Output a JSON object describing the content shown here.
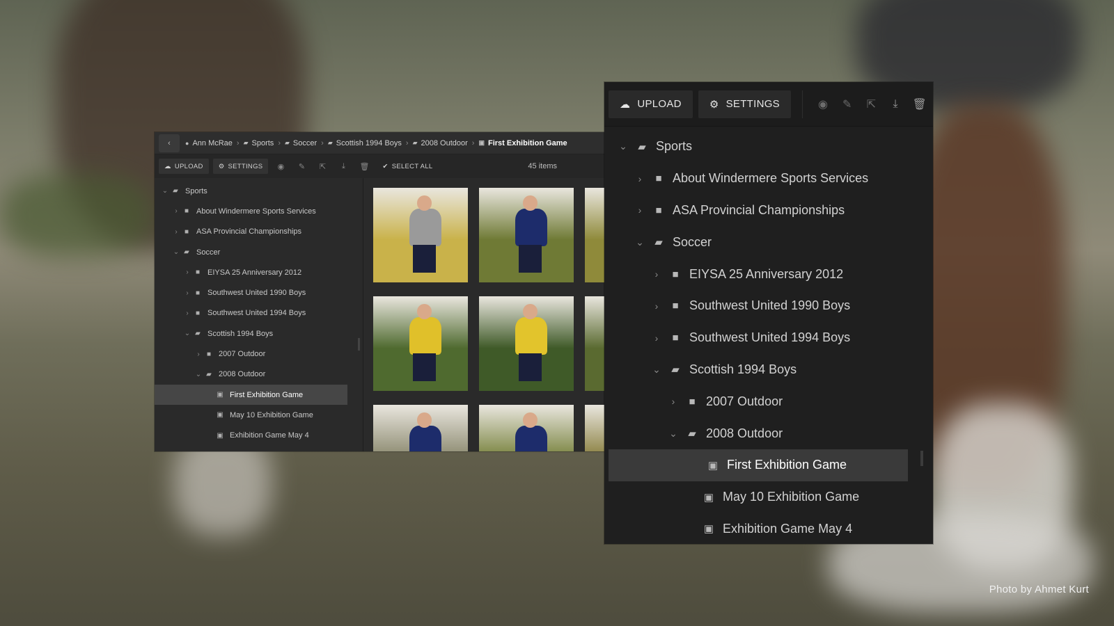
{
  "photo_credit": "Photo by Ahmet Kurt",
  "small_window": {
    "breadcrumbs": [
      {
        "label": "Ann McRae",
        "icon": "user-icon"
      },
      {
        "label": "Sports",
        "icon": "folder-open-icon"
      },
      {
        "label": "Soccer",
        "icon": "folder-open-icon"
      },
      {
        "label": "Scottish 1994 Boys",
        "icon": "folder-open-icon"
      },
      {
        "label": "2008 Outdoor",
        "icon": "folder-open-icon"
      },
      {
        "label": "First Exhibition Game",
        "icon": "gallery-icon"
      }
    ],
    "toolbar": {
      "upload_label": "UPLOAD",
      "settings_label": "SETTINGS",
      "select_all_label": "SELECT ALL",
      "item_count": "45 items"
    },
    "tree": [
      {
        "label": "Sports",
        "depth": 0,
        "chevron": "down",
        "icon": "folder-open-icon"
      },
      {
        "label": "About Windermere Sports Services",
        "depth": 1,
        "chevron": "right",
        "icon": "folder-icon"
      },
      {
        "label": "ASA Provincial Championships",
        "depth": 1,
        "chevron": "right",
        "icon": "folder-icon"
      },
      {
        "label": "Soccer",
        "depth": 1,
        "chevron": "down",
        "icon": "folder-open-icon"
      },
      {
        "label": "EIYSA 25 Anniversary 2012",
        "depth": 2,
        "chevron": "right",
        "icon": "folder-icon"
      },
      {
        "label": "Southwest United 1990 Boys",
        "depth": 2,
        "chevron": "right",
        "icon": "folder-icon"
      },
      {
        "label": "Southwest United 1994 Boys",
        "depth": 2,
        "chevron": "right",
        "icon": "folder-icon"
      },
      {
        "label": "Scottish  1994 Boys",
        "depth": 2,
        "chevron": "down",
        "icon": "folder-open-icon"
      },
      {
        "label": "2007 Outdoor",
        "depth": 3,
        "chevron": "right",
        "icon": "folder-icon"
      },
      {
        "label": "2008 Outdoor",
        "depth": 3,
        "chevron": "down",
        "icon": "folder-open-icon"
      },
      {
        "label": "First Exhibition Game",
        "depth": 4,
        "chevron": "none",
        "icon": "gallery-icon",
        "selected": true
      },
      {
        "label": "May 10 Exhibition Game",
        "depth": 4,
        "chevron": "none",
        "icon": "gallery-icon"
      },
      {
        "label": "Exhibition Game May 4",
        "depth": 4,
        "chevron": "none",
        "icon": "gallery-icon"
      }
    ]
  },
  "large_panel": {
    "toolbar": {
      "upload_label": "UPLOAD",
      "settings_label": "SETTINGS"
    },
    "tree": [
      {
        "label": "Sports",
        "depth": 0,
        "chevron": "down",
        "icon": "folder-open-icon"
      },
      {
        "label": "About Windermere Sports Services",
        "depth": 1,
        "chevron": "right",
        "icon": "folder-icon"
      },
      {
        "label": "ASA Provincial Championships",
        "depth": 1,
        "chevron": "right",
        "icon": "folder-icon"
      },
      {
        "label": "Soccer",
        "depth": 1,
        "chevron": "down",
        "icon": "folder-open-icon"
      },
      {
        "label": "EIYSA 25 Anniversary 2012",
        "depth": 2,
        "chevron": "right",
        "icon": "folder-icon"
      },
      {
        "label": "Southwest United 1990 Boys",
        "depth": 2,
        "chevron": "right",
        "icon": "folder-icon"
      },
      {
        "label": "Southwest United 1994 Boys",
        "depth": 2,
        "chevron": "right",
        "icon": "folder-icon"
      },
      {
        "label": "Scottish  1994 Boys",
        "depth": 2,
        "chevron": "down",
        "icon": "folder-open-icon"
      },
      {
        "label": "2007 Outdoor",
        "depth": 3,
        "chevron": "right",
        "icon": "folder-icon"
      },
      {
        "label": "2008 Outdoor",
        "depth": 3,
        "chevron": "down",
        "icon": "folder-open-icon"
      },
      {
        "label": "First Exhibition Game",
        "depth": 4,
        "chevron": "none",
        "icon": "gallery-icon",
        "selected": true
      },
      {
        "label": "May 10 Exhibition Game",
        "depth": 4,
        "chevron": "none",
        "icon": "gallery-icon"
      },
      {
        "label": "Exhibition Game May 4",
        "depth": 4,
        "chevron": "none",
        "icon": "gallery-icon"
      }
    ]
  },
  "thumbnails": [
    {
      "name": "goalkeeper-photo",
      "bg": "#c9b24a",
      "jersey": "#9a9a9a"
    },
    {
      "name": "player-running-photo",
      "bg": "#6f7a35",
      "jersey": "#1d2c6b"
    },
    {
      "name": "partial-photo",
      "bg": "#8f8a3a",
      "jersey": "#d8c230"
    },
    {
      "name": "tackle-photo",
      "bg": "#4f6a2f",
      "jersey": "#e0c02a"
    },
    {
      "name": "header-duel-photo",
      "bg": "#3f5a28",
      "jersey": "#e2c42c"
    },
    {
      "name": "partial-photo-2",
      "bg": "#5a6a30",
      "jersey": "#1d2c6b"
    },
    {
      "name": "action-photo",
      "bg": "#8c8a70",
      "jersey": "#1d2c6b"
    },
    {
      "name": "kick-photo",
      "bg": "#7a8440",
      "jersey": "#1d2c6b"
    },
    {
      "name": "partial-photo-3",
      "bg": "#8a8040",
      "jersey": "#d8c230"
    }
  ]
}
